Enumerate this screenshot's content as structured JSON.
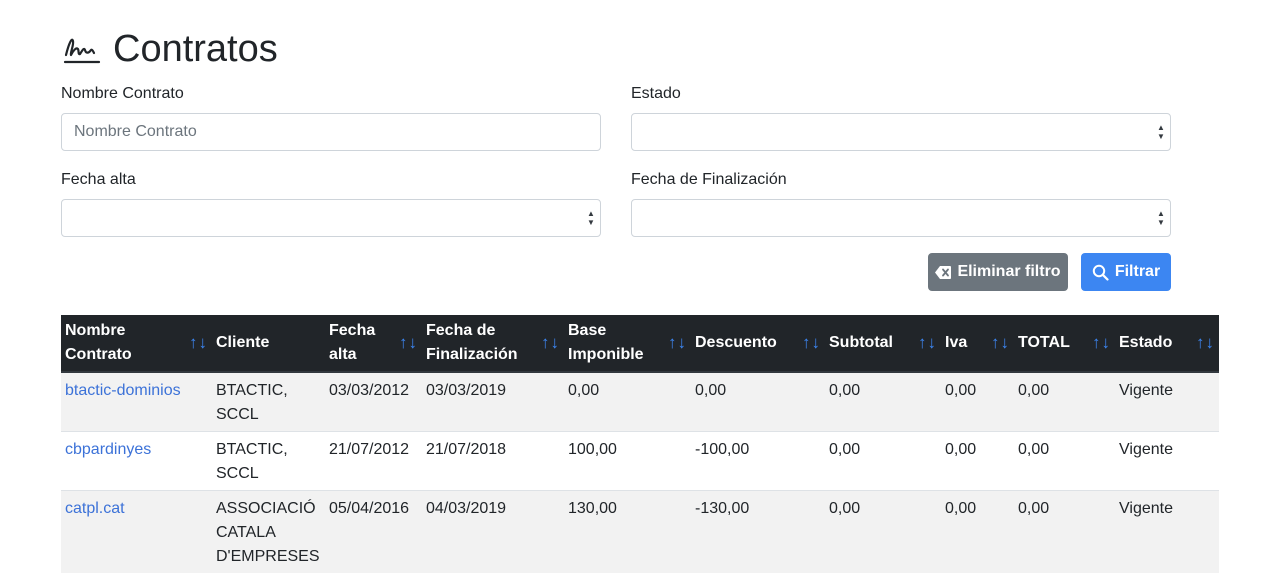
{
  "page": {
    "title": "Contratos",
    "title_icon": "signature-icon"
  },
  "filters": {
    "nombre_label": "Nombre Contrato",
    "nombre_placeholder": "Nombre Contrato",
    "nombre_value": "",
    "estado_label": "Estado",
    "estado_value": "",
    "fecha_alta_label": "Fecha alta",
    "fecha_alta_value": "",
    "fecha_fin_label": "Fecha de Finalización",
    "fecha_fin_value": ""
  },
  "actions": {
    "clear_label": "Eliminar filtro",
    "clear_icon": "backspace-icon",
    "filter_label": "Filtrar",
    "filter_icon": "search-icon"
  },
  "colors": {
    "primary": "#3c86f2",
    "secondary": "#6c757d",
    "header_bg": "#212529",
    "link": "#3c72d8"
  },
  "table": {
    "sort_glyph": "↑↓",
    "headers": [
      "Nombre Contrato",
      "Cliente",
      "Fecha alta",
      "Fecha de Finalización",
      "Base Imponible",
      "Descuento",
      "Subtotal",
      "Iva",
      "TOTAL",
      "Estado"
    ],
    "rows": [
      [
        "btactic-dominios",
        "BTACTIC, SCCL",
        "03/03/2012",
        "03/03/2019",
        "0,00",
        "0,00",
        "0,00",
        "0,00",
        "0,00",
        "Vigente"
      ],
      [
        "cbpardinyes",
        "BTACTIC, SCCL",
        "21/07/2012",
        "21/07/2018",
        "100,00",
        "-100,00",
        "0,00",
        "0,00",
        "0,00",
        "Vigente"
      ],
      [
        "catpl.cat",
        "ASSOCIACIÓ CATALA D'EMPRESES",
        "05/04/2016",
        "04/03/2019",
        "130,00",
        "-130,00",
        "0,00",
        "0,00",
        "0,00",
        "Vigente"
      ]
    ]
  }
}
